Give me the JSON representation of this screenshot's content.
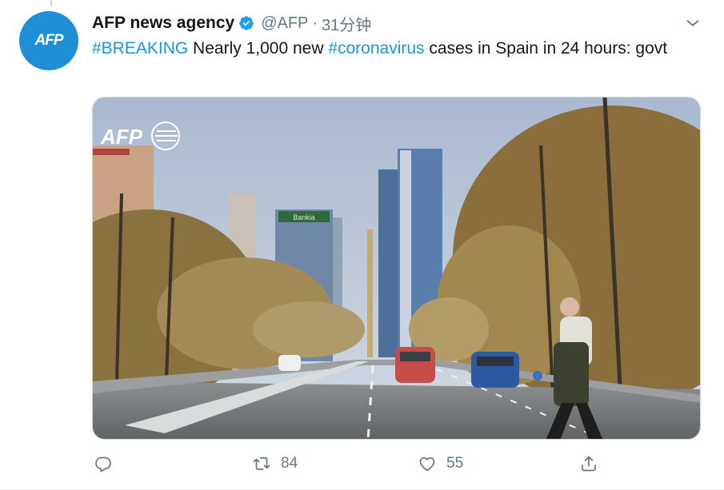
{
  "tweet": {
    "author_name": "AFP news agency",
    "handle": "@AFP",
    "separator": "·",
    "time": "31分钟",
    "avatar_text": "AFP",
    "text_parts": [
      {
        "type": "hashtag",
        "text": "#BREAKING"
      },
      {
        "type": "text",
        "text": " Nearly 1,000 new "
      },
      {
        "type": "hashtag",
        "text": "#coronavirus"
      },
      {
        "type": "text",
        "text": " cases in Spain in 24 hours: govt"
      }
    ],
    "media": {
      "watermark": "AFP",
      "building_sign": "Bankia"
    },
    "actions": {
      "reply_count": "",
      "retweet_count": "84",
      "like_count": "55"
    }
  },
  "icons": {
    "verified": "verified-badge-icon",
    "caret": "chevron-down-icon",
    "reply": "reply-icon",
    "retweet": "retweet-icon",
    "like": "heart-icon",
    "share": "share-icon"
  },
  "colors": {
    "link": "#1b95e0",
    "secondary_text": "#657786",
    "avatar_bg": "#1e8fd6",
    "border": "#ccd6dd"
  }
}
